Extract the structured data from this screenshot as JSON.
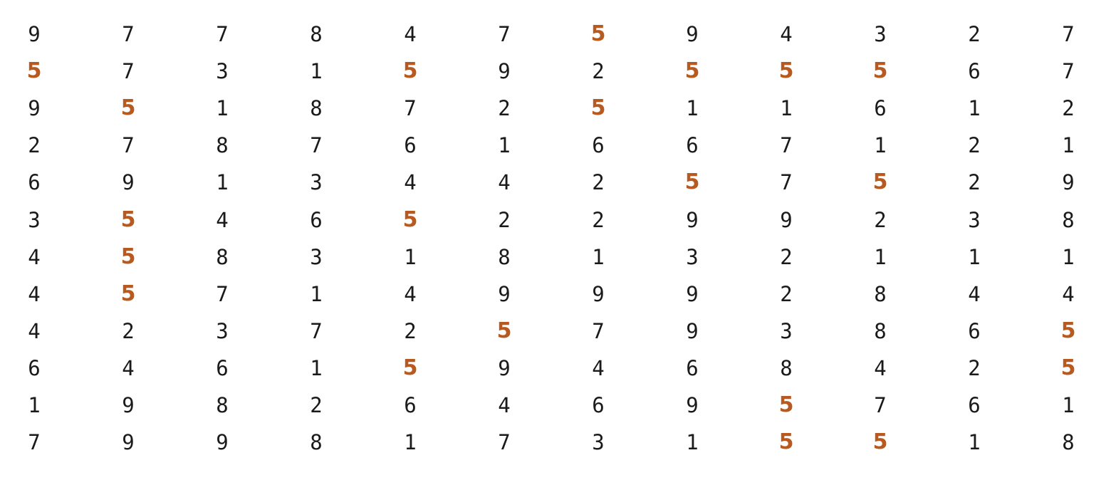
{
  "grid": {
    "highlight_digit": "5",
    "highlight_color": "#b85a20",
    "text_color": "#1a1a1a",
    "rows": [
      [
        "9",
        "7",
        "7",
        "8",
        "4",
        "7",
        "5",
        "9",
        "4",
        "3",
        "2",
        "7"
      ],
      [
        "5",
        "7",
        "3",
        "1",
        "5",
        "9",
        "2",
        "5",
        "5",
        "5",
        "6",
        "7"
      ],
      [
        "9",
        "5",
        "1",
        "8",
        "7",
        "2",
        "5",
        "1",
        "1",
        "6",
        "1",
        "2"
      ],
      [
        "2",
        "7",
        "8",
        "7",
        "6",
        "1",
        "6",
        "6",
        "7",
        "1",
        "2",
        "1"
      ],
      [
        "6",
        "9",
        "1",
        "3",
        "4",
        "4",
        "2",
        "5",
        "7",
        "5",
        "2",
        "9"
      ],
      [
        "3",
        "5",
        "4",
        "6",
        "5",
        "2",
        "2",
        "9",
        "9",
        "2",
        "3",
        "8"
      ],
      [
        "4",
        "5",
        "8",
        "3",
        "1",
        "8",
        "1",
        "3",
        "2",
        "1",
        "1",
        "1"
      ],
      [
        "4",
        "5",
        "7",
        "1",
        "4",
        "9",
        "9",
        "9",
        "2",
        "8",
        "4",
        "4"
      ],
      [
        "4",
        "2",
        "3",
        "7",
        "2",
        "5",
        "7",
        "9",
        "3",
        "8",
        "6",
        "5"
      ],
      [
        "6",
        "4",
        "6",
        "1",
        "5",
        "9",
        "4",
        "6",
        "8",
        "4",
        "2",
        "5"
      ],
      [
        "1",
        "9",
        "8",
        "2",
        "6",
        "4",
        "6",
        "9",
        "5",
        "7",
        "6",
        "1"
      ],
      [
        "7",
        "9",
        "9",
        "8",
        "1",
        "7",
        "3",
        "1",
        "5",
        "5",
        "1",
        "8"
      ]
    ]
  }
}
